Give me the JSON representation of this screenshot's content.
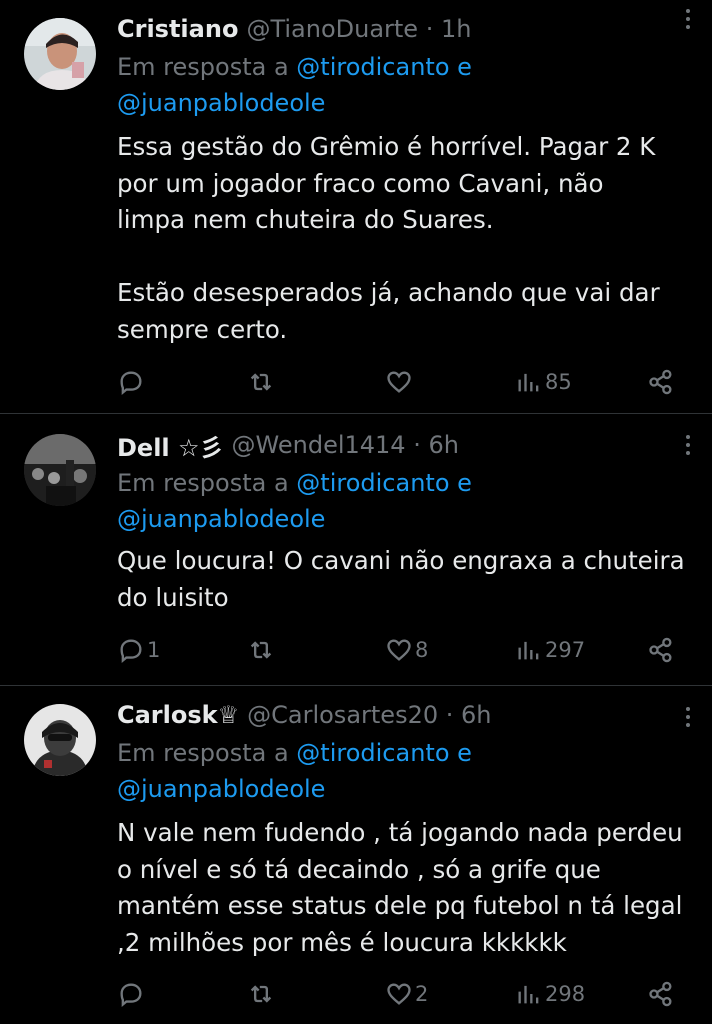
{
  "tweets": [
    {
      "name": "Cristiano",
      "handle": "@TianoDuarte · 1h",
      "reply_prefix": "Em resposta a ",
      "mention1": "@tirodicanto e",
      "mention2": "@juanpablodeole",
      "text": "Essa gestão do Grêmio é horrível. Pagar 2 K\npor um jogador fraco como Cavani, não\nlimpa nem chuteira do Suares.\n\nEstão desesperados já, achando que vai dar\nsempre certo.",
      "replies": "",
      "retweets": "",
      "likes": "",
      "views": "85"
    },
    {
      "name": "Dell ☆彡",
      "handle": "@Wendel1414 · 6h",
      "reply_prefix": "Em resposta a ",
      "mention1": "@tirodicanto e",
      "mention2": "@juanpablodeole",
      "text": "Que loucura! O cavani não engraxa a chuteira\ndo luisito",
      "replies": "1",
      "retweets": "",
      "likes": "8",
      "views": "297"
    },
    {
      "name": "Carlosk♕",
      "handle": "@Carlosartes20 · 6h",
      "reply_prefix": "Em resposta a ",
      "mention1": "@tirodicanto e",
      "mention2": "@juanpablodeole",
      "text": "N vale nem fudendo , tá jogando nada perdeu\no nível e só tá decaindo , só a grife que\nmantém esse status dele pq futebol n tá legal\n,2 milhões por mês é loucura kkkkkk",
      "replies": "",
      "retweets": "",
      "likes": "2",
      "views": "298"
    }
  ],
  "colors": {
    "background": "#000000",
    "text": "#e7e9ea",
    "muted": "#71767b",
    "link": "#1d9bf0",
    "divider": "#2f3336"
  }
}
